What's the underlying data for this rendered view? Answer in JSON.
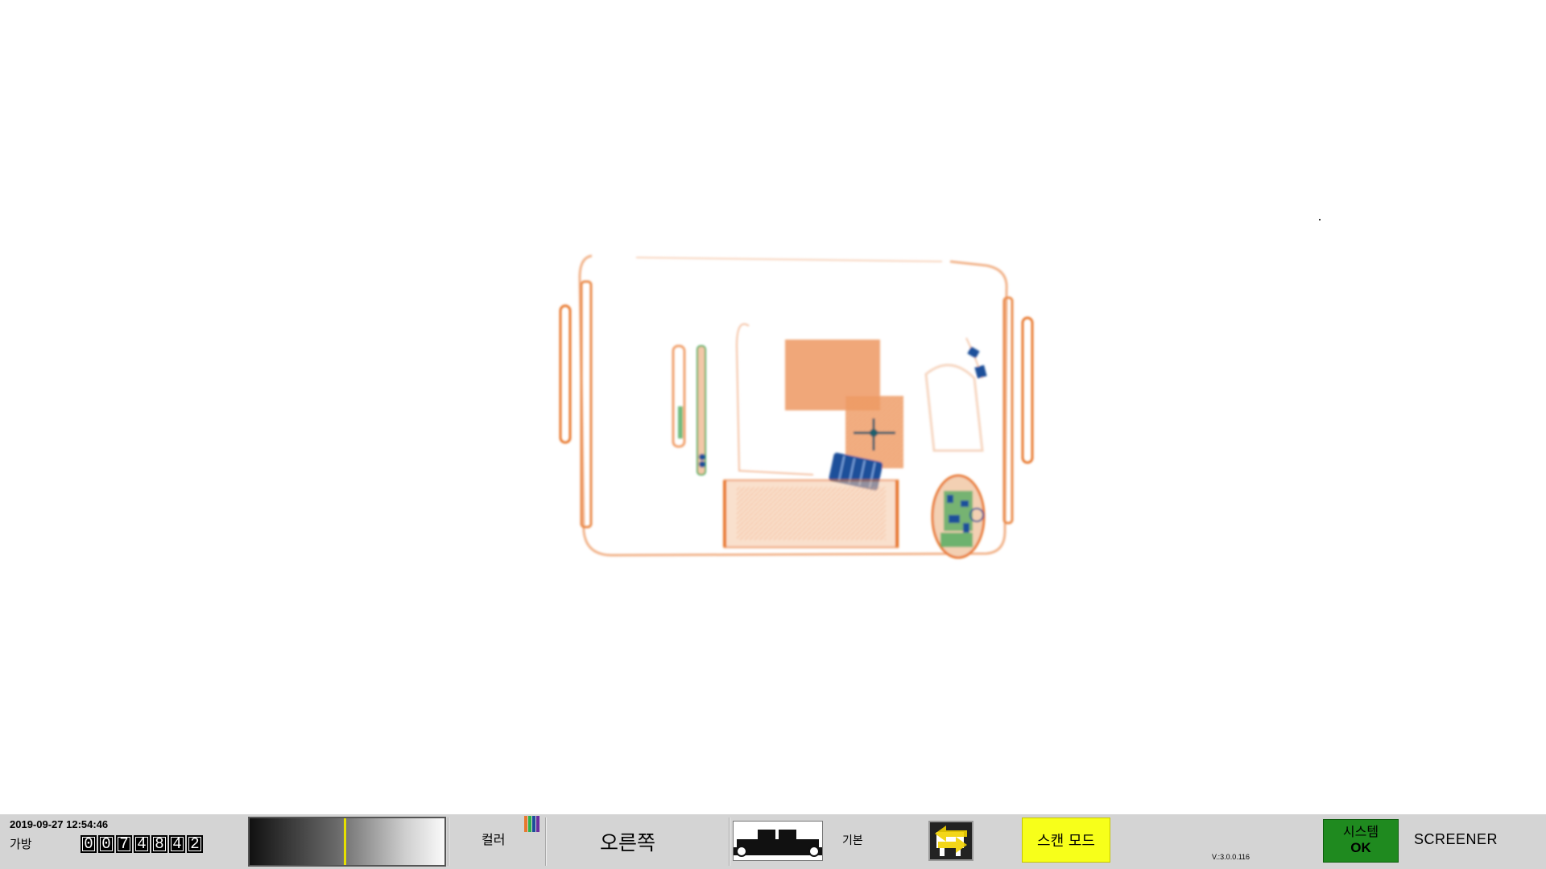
{
  "viewer": {
    "scan_image": "xray-bag-scan",
    "palette": {
      "organic": "#e8782e",
      "inorganic": "#4caa5c",
      "metal": "#1d4f9a",
      "background": "#ffffff"
    }
  },
  "statusbar": {
    "datetime": "2019-09-27 12:54:46",
    "bag_label": "가방",
    "bag_count_digits": [
      "0",
      "0",
      "7",
      "4",
      "8",
      "4",
      "2"
    ],
    "gray_marker_fraction": 0.49,
    "color_label": "컬러",
    "color_bars": [
      "#e8782e",
      "#2fb34a",
      "#1d4f9a",
      "#6b2fa0"
    ],
    "direction_label": "오른쪽",
    "conveyor_icon": "conveyor-belt-icon",
    "basic_label": "기본",
    "image_mode_icon": "image-processing-icon",
    "scan_mode_label": "스캔 모드",
    "scan_mode_color": "#f7ff1a",
    "version_label": "V.:3.0.0.116",
    "system_label": "시스템",
    "system_status": "OK",
    "system_status_color": "#1f8a1f",
    "user_role": "SCREENER"
  }
}
